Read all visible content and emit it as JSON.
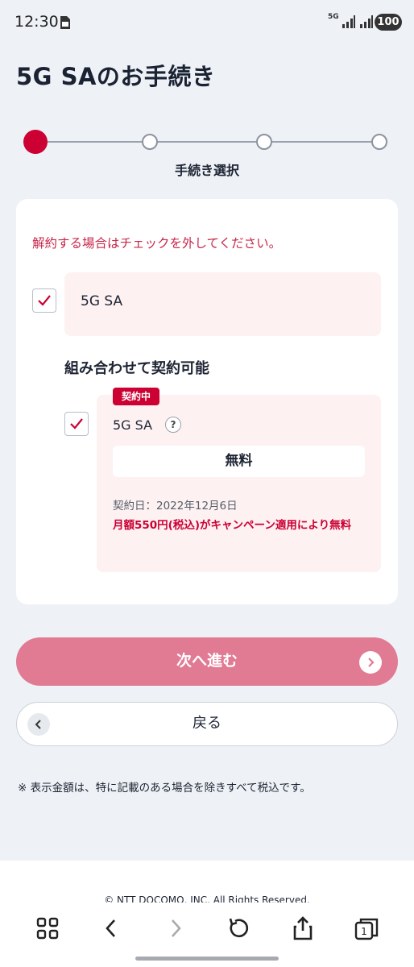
{
  "status_bar": {
    "time": "12:30",
    "network": "5G",
    "battery": "100"
  },
  "page": {
    "title": "5G SAのお手続き"
  },
  "stepper": {
    "current_label": "手続き選択",
    "current_step": 1,
    "total_steps": 4
  },
  "card": {
    "notice": "解約する場合はチェックを外してください。",
    "main_plan": {
      "name": "5G SA",
      "checked": true
    },
    "combo_heading": "組み合わせて契約可能",
    "sub_plan": {
      "badge": "契約中",
      "name": "5G SA",
      "help": "?",
      "price": "無料",
      "contract_date": "契約日：2022年12月6日",
      "campaign": "月額550円(税込)がキャンペーン適用により無料",
      "checked": true
    }
  },
  "buttons": {
    "next_label": "次へ進む",
    "back_label": "戻る"
  },
  "tax_note": "※ 表示金額は、特に記載のある場合を除きすべて税込です。",
  "footer": {
    "copyright": "© NTT DOCOMO, INC. All Rights Reserved."
  },
  "colors": {
    "accent": "#cc0033",
    "next_button": "#e17a93",
    "plan_background": "#fdf1f2",
    "page_background": "#eef2f6"
  }
}
